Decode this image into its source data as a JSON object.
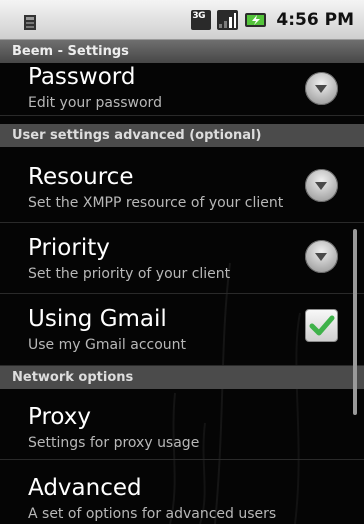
{
  "status_bar": {
    "network_type": "3G",
    "time": "4:56 PM"
  },
  "window": {
    "title": "Beem - Settings"
  },
  "preferences": {
    "password": {
      "title": "Password",
      "summary": "Edit your password"
    },
    "category_advanced": "User settings advanced (optional)",
    "resource": {
      "title": "Resource",
      "summary": "Set the XMPP resource of your client"
    },
    "priority": {
      "title": "Priority",
      "summary": "Set the priority of your client"
    },
    "using_gmail": {
      "title": "Using Gmail",
      "summary": "Use my Gmail account",
      "checked": true
    },
    "category_network": "Network options",
    "proxy": {
      "title": "Proxy",
      "summary": "Settings for proxy usage"
    },
    "advanced": {
      "title": "Advanced",
      "summary": "A set of options for advanced users"
    }
  },
  "colors": {
    "check_green": "#3fb24a",
    "category_bg": "#4b4b4b",
    "status_bar_bg": "#e6e6e6"
  }
}
